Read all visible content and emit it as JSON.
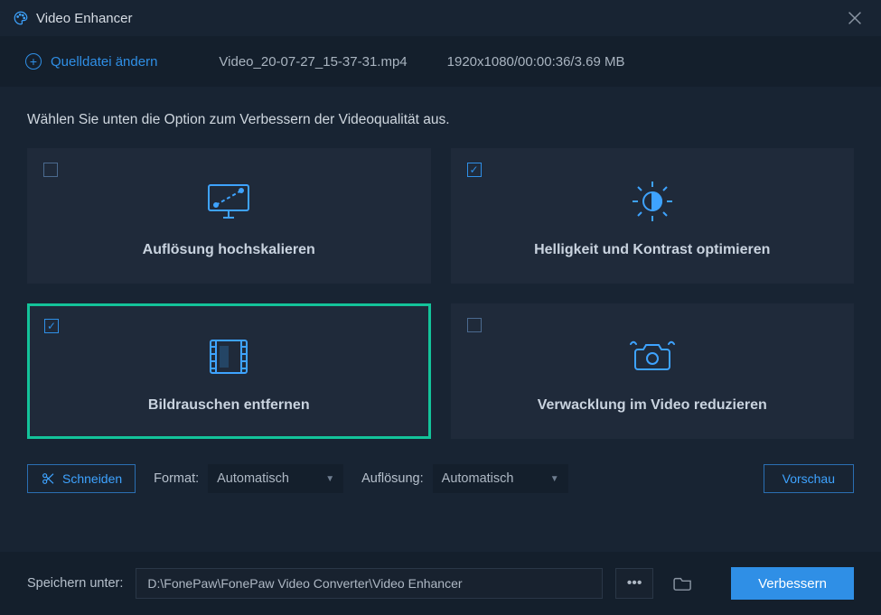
{
  "titlebar": {
    "title": "Video Enhancer"
  },
  "source": {
    "change_label": "Quelldatei ändern",
    "filename": "Video_20-07-27_15-37-31.mp4",
    "metadata": "1920x1080/00:00:36/3.69 MB"
  },
  "prompt": "Wählen Sie unten die Option zum Verbessern der Videoqualität aus.",
  "cards": {
    "upscale": {
      "label": "Auflösung hochskalieren",
      "checked": false
    },
    "brightness": {
      "label": "Helligkeit und Kontrast optimieren",
      "checked": true
    },
    "denoise": {
      "label": "Bildrauschen entfernen",
      "checked": true
    },
    "deshake": {
      "label": "Verwacklung im Video reduzieren",
      "checked": false
    }
  },
  "controls": {
    "cut_label": "Schneiden",
    "format_label": "Format:",
    "format_value": "Automatisch",
    "resolution_label": "Auflösung:",
    "resolution_value": "Automatisch",
    "preview_label": "Vorschau"
  },
  "footer": {
    "save_label": "Speichern unter:",
    "path": "D:\\FonePaw\\FonePaw Video Converter\\Video Enhancer",
    "enhance_label": "Verbessern"
  }
}
